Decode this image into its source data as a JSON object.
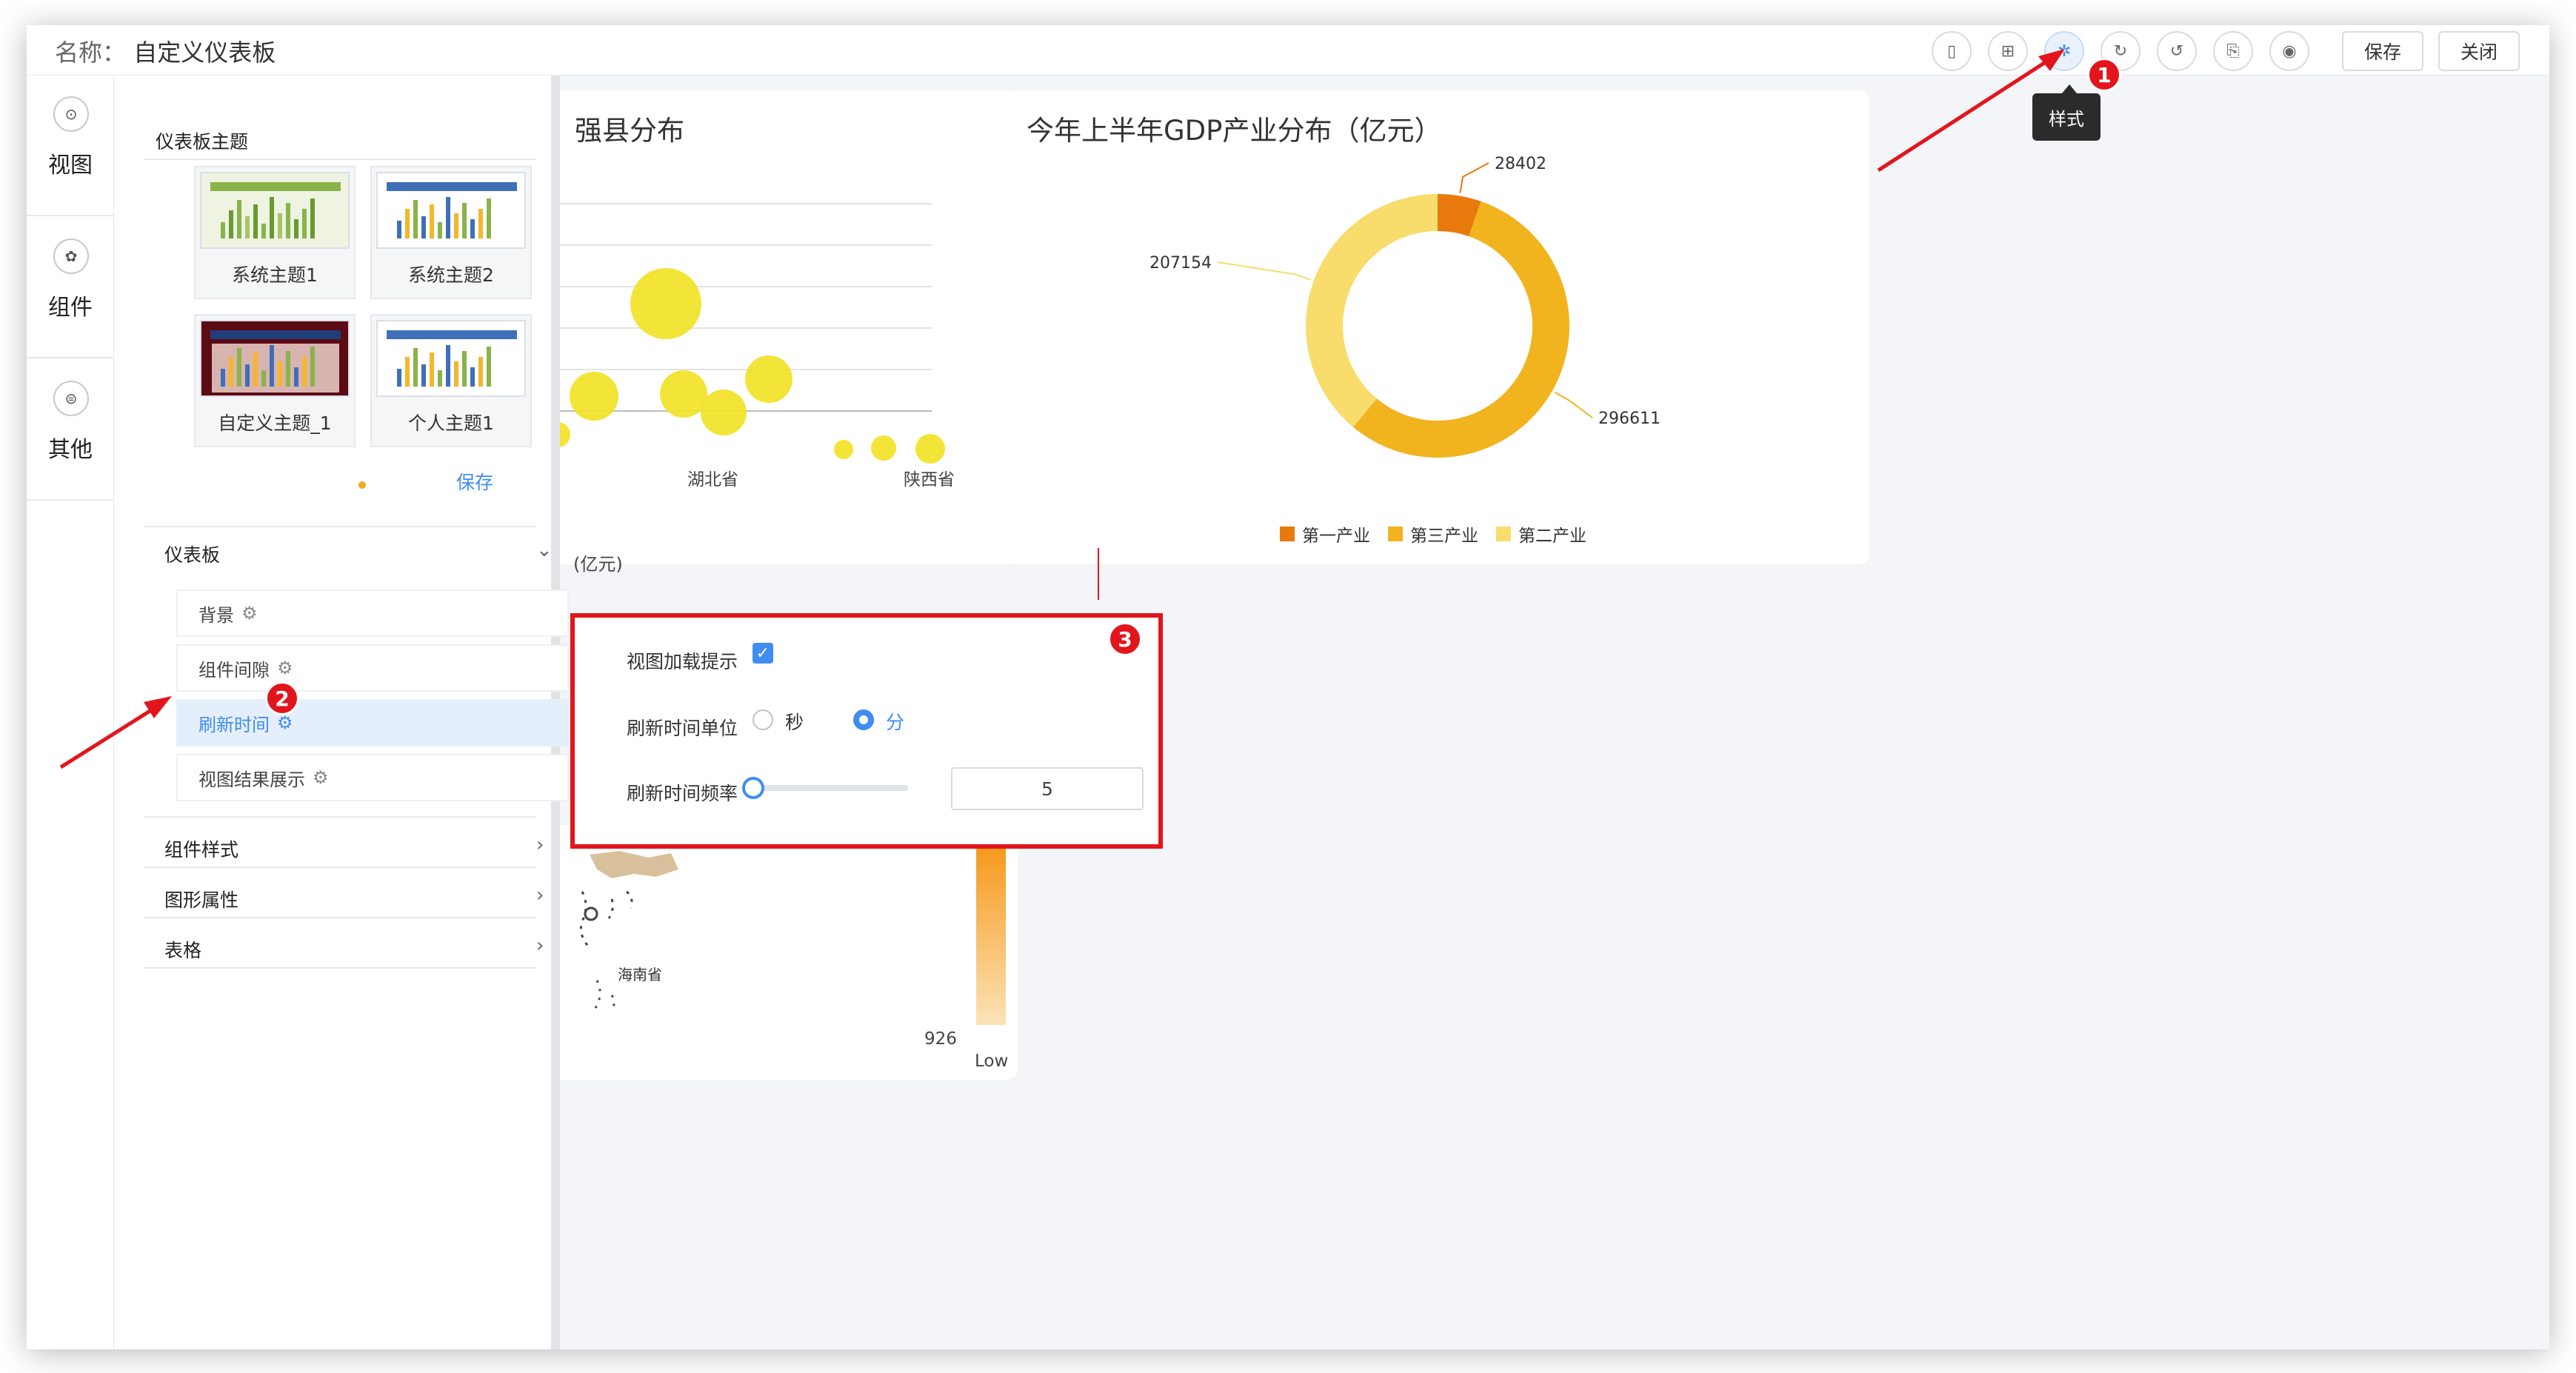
{
  "header": {
    "name_label": "名称：",
    "name_value": "自定义仪表板",
    "toolbar_icons": [
      "mobile-icon",
      "grid-icon",
      "style-icon",
      "refresh-icon",
      "undo-icon",
      "export-icon",
      "preview-icon"
    ],
    "save_label": "保存",
    "close_label": "关闭",
    "tooltip": "样式"
  },
  "annotations": {
    "one": "1",
    "two": "2",
    "three": "3"
  },
  "rail": [
    {
      "label": "视图",
      "icon": "view-icon"
    },
    {
      "label": "组件",
      "icon": "component-icon"
    },
    {
      "label": "其他",
      "icon": "other-icon"
    }
  ],
  "panel": {
    "themes_title": "仪表板主题",
    "themes": [
      {
        "name": "系统主题1",
        "header": "#8ab34a",
        "bg": "#eef3e2",
        "bars": [
          "#8ab34a",
          "#6a9a2f",
          "#a7c66a"
        ]
      },
      {
        "name": "系统主题2",
        "header": "#3f6fb8",
        "bg": "#ffffff",
        "bars": [
          "#3f6fb8",
          "#f5b62a",
          "#8ab34a"
        ]
      },
      {
        "name": "自定义主题_1",
        "header": "#1e3f7a",
        "bg": "#5c0a14",
        "bars": [
          "#3f6fb8",
          "#f5b62a",
          "#8ab34a"
        ]
      },
      {
        "name": "个人主题1",
        "header": "#3f6fb8",
        "bg": "#ffffff",
        "bars": [
          "#3f6fb8",
          "#f5b62a",
          "#8ab34a"
        ]
      }
    ],
    "save_link": "保存",
    "dashboard_section": "仪表板",
    "dashboard_items": [
      {
        "label": "背景"
      },
      {
        "label": "组件间隙"
      },
      {
        "label": "刷新时间"
      },
      {
        "label": "视图结果展示"
      }
    ],
    "collapsed_sections": [
      "组件样式",
      "图形属性",
      "表格"
    ]
  },
  "bubble_card": {
    "title": "强县分布",
    "x_labels": [
      "湖北省",
      "陕西省"
    ],
    "footer": "(亿元)"
  },
  "donut_card": {
    "title": "今年上半年GDP产业分布（亿元）",
    "legend": [
      "第一产业",
      "第三产业",
      "第二产业"
    ]
  },
  "chart_data": {
    "type": "pie",
    "title": "今年上半年GDP产业分布（亿元）",
    "donut": true,
    "categories": [
      "第一产业",
      "第三产业",
      "第二产业"
    ],
    "values": [
      28402,
      296611,
      207154
    ],
    "data_labels": [
      "28402",
      "296611",
      "207154"
    ],
    "colors": [
      "#e8790c",
      "#f1b41f",
      "#f8dc6c"
    ],
    "legend_position": "bottom"
  },
  "map_card": {
    "province_label": "海南省",
    "scale_value": "926",
    "scale_low": "Low"
  },
  "popup": {
    "load_tip_label": "视图加载提示",
    "load_tip_checked": true,
    "unit_label": "刷新时间单位",
    "unit_options": [
      "秒",
      "分"
    ],
    "unit_selected": "分",
    "freq_label": "刷新时间频率",
    "freq_value": "5"
  }
}
